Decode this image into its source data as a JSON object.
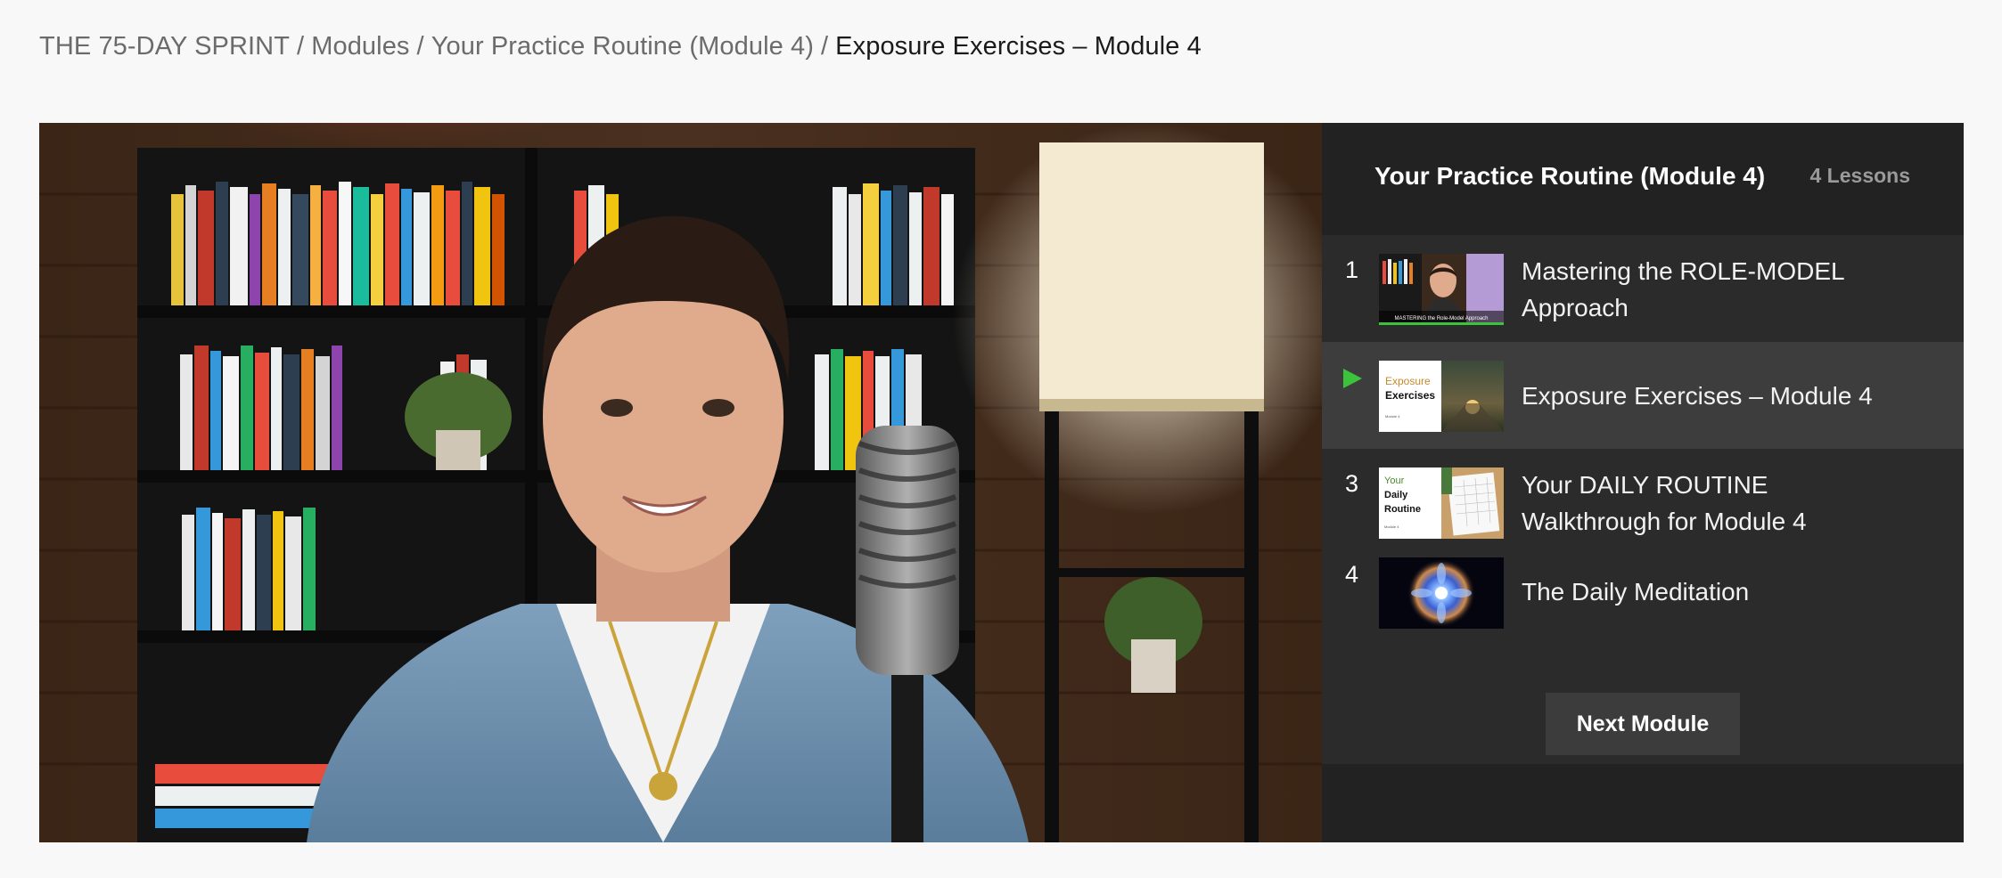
{
  "breadcrumb": {
    "items": [
      "THE 75-DAY SPRINT",
      "Modules",
      "Your Practice Routine (Module 4)"
    ],
    "separator": "/",
    "current": "Exposure Exercises – Module 4"
  },
  "sidebar": {
    "title": "Your Practice Routine (Module 4)",
    "lesson_count": "4 Lessons",
    "lessons": [
      {
        "number": "1",
        "title": "Mastering the ROLE-MODEL Approach",
        "thumb_text": "MASTERING the Role-Model Approach"
      },
      {
        "number": "",
        "title": "Exposure Exercises – Module 4",
        "active": true,
        "thumb_line1": "Exposure",
        "thumb_line2": "Exercises",
        "thumb_small": "Module 4"
      },
      {
        "number": "3",
        "title": "Your DAILY ROUTINE Walkthrough for Module 4",
        "thumb_line1": "Your",
        "thumb_line2": "Daily",
        "thumb_line3": "Routine",
        "thumb_small": "Module 4"
      },
      {
        "number": "4",
        "title": "The Daily Meditation"
      }
    ],
    "next_button": "Next Module"
  },
  "colors": {
    "active_play": "#3cc33c",
    "sidebar_bg": "#222222",
    "list_bg": "#2b2b2b",
    "active_row": "#3d3d3d"
  },
  "icons": {
    "play": "play-icon"
  }
}
